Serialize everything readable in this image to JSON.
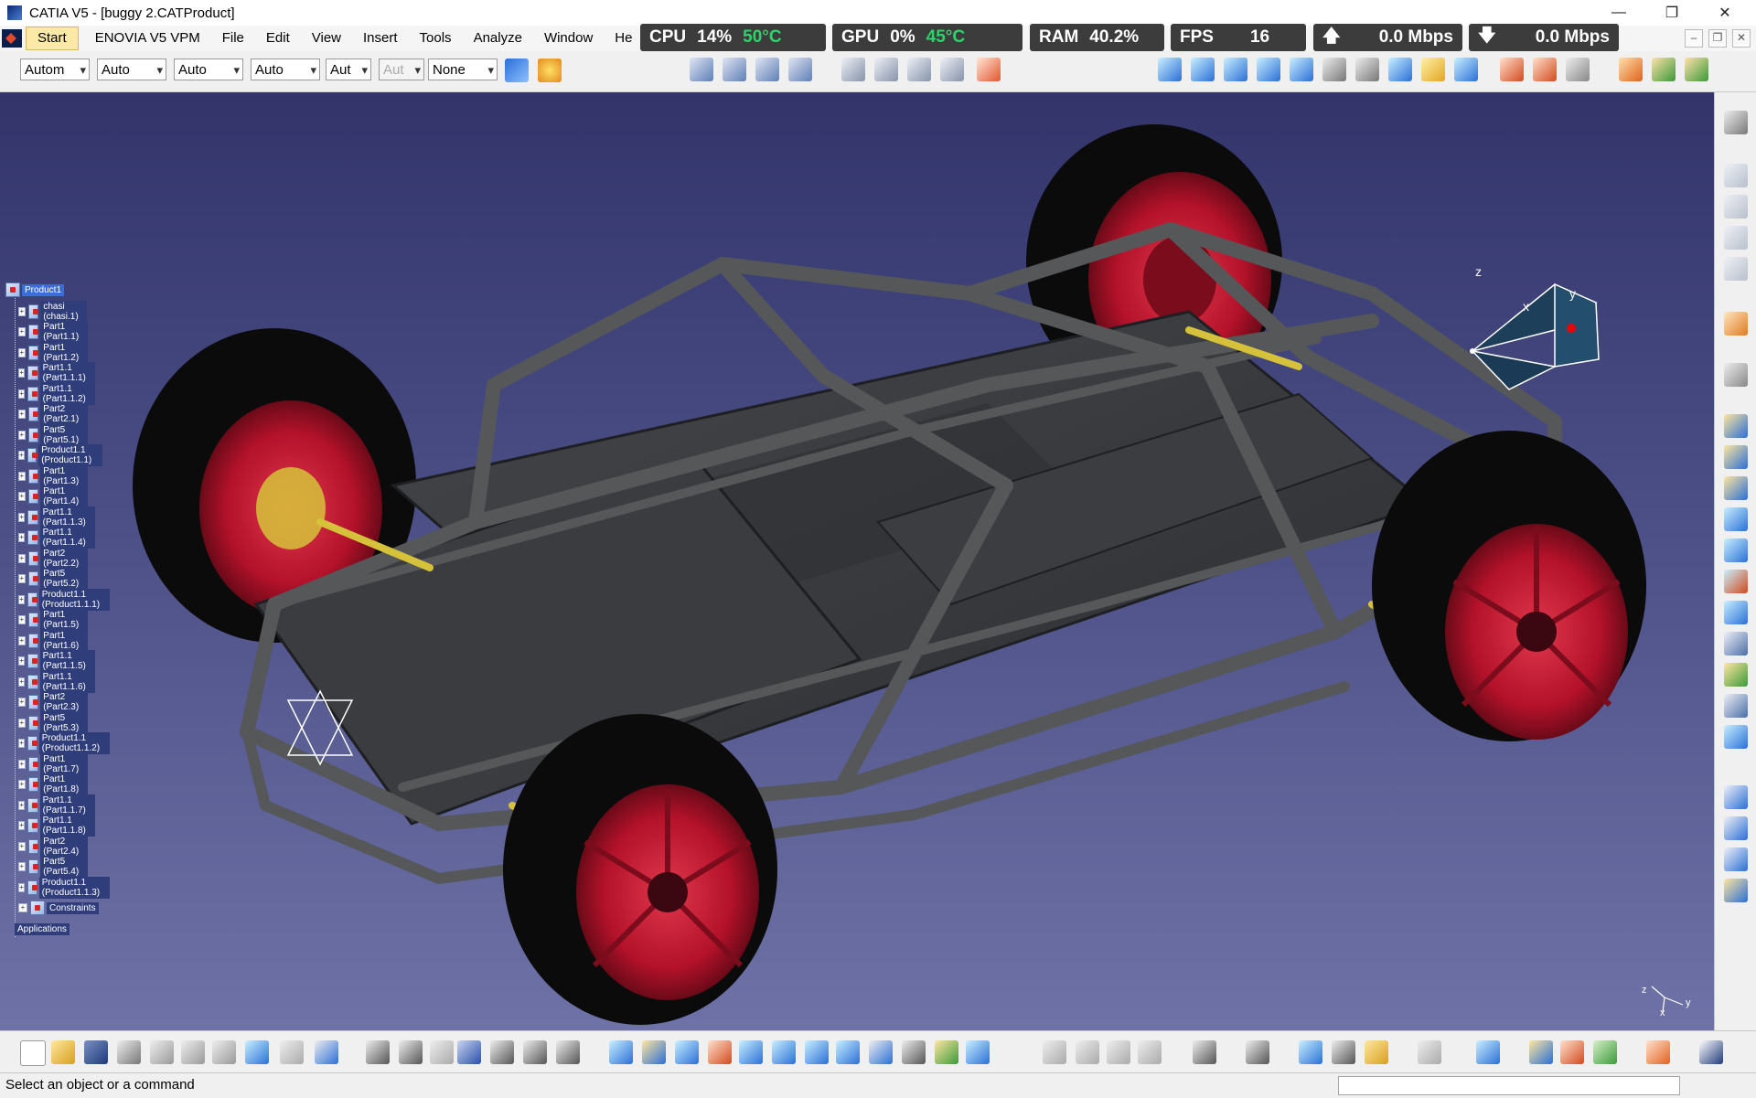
{
  "window": {
    "title": "CATIA V5 - [buggy 2.CATProduct]",
    "controls": {
      "minimize": "—",
      "maximize": "❐",
      "close": "✕"
    }
  },
  "menubar": {
    "items": [
      {
        "label": "Start"
      },
      {
        "label": "ENOVIA V5 VPM"
      },
      {
        "label": "File"
      },
      {
        "label": "Edit"
      },
      {
        "label": "View"
      },
      {
        "label": "Insert"
      },
      {
        "label": "Tools"
      },
      {
        "label": "Analyze"
      },
      {
        "label": "Window"
      },
      {
        "label": "He"
      }
    ],
    "mdi_controls": [
      "–",
      "❐",
      "✕"
    ]
  },
  "overlay_stats": {
    "cpu": {
      "label": "CPU",
      "value": "14%",
      "temp": "50°C"
    },
    "gpu": {
      "label": "GPU",
      "value": "0%",
      "temp": "45°C"
    },
    "ram": {
      "label": "RAM",
      "value": "40.2%"
    },
    "fps": {
      "label": "FPS",
      "value": "16"
    },
    "upload": {
      "arrow": "🡅",
      "value": "0.0 Mbps"
    },
    "download": {
      "arrow": "🡇",
      "value": "0.0 Mbps"
    },
    "temp_color": "#2bd46b"
  },
  "graphic_properties": {
    "combos": [
      "Autom",
      "Auto",
      "Auto",
      "Auto",
      "Aut",
      "Aut",
      "None"
    ]
  },
  "tree": {
    "root": "Product1",
    "nodes": [
      "chasi (chasi.1)",
      "Part1 (Part1.1)",
      "Part1 (Part1.2)",
      "Part1.1 (Part1.1.1)",
      "Part1.1 (Part1.1.2)",
      "Part2 (Part2.1)",
      "Part5 (Part5.1)",
      "Product1.1 (Product1.1)",
      "Part1 (Part1.3)",
      "Part1 (Part1.4)",
      "Part1.1 (Part1.1.3)",
      "Part1.1 (Part1.1.4)",
      "Part2 (Part2.2)",
      "Part5 (Part5.2)",
      "Product1.1 (Product1.1.1)",
      "Part1 (Part1.5)",
      "Part1 (Part1.6)",
      "Part1.1 (Part1.1.5)",
      "Part1.1 (Part1.1.6)",
      "Part2 (Part2.3)",
      "Part5 (Part5.3)",
      "Product1.1 (Product1.1.2)",
      "Part1 (Part1.7)",
      "Part1 (Part1.8)",
      "Part1.1 (Part1.1.7)",
      "Part1.1 (Part1.1.8)",
      "Part2 (Part2.4)",
      "Part5 (Part5.4)",
      "Product1.1 (Product1.1.3)",
      "Constraints"
    ],
    "applications": "Applications"
  },
  "compass": {
    "x": "x",
    "y": "y",
    "z": "z"
  },
  "axis_triad": {
    "x": "x",
    "y": "y",
    "z": "z"
  },
  "colors": {
    "viewport_top": "#32346a",
    "viewport_bottom": "#6e72a6",
    "rim": "#b3122a",
    "tire": "#0b0b0b",
    "frame": "#4a4c4f",
    "accent_yellow": "#d6c23a"
  },
  "status": {
    "message": "Select an object or a command"
  }
}
